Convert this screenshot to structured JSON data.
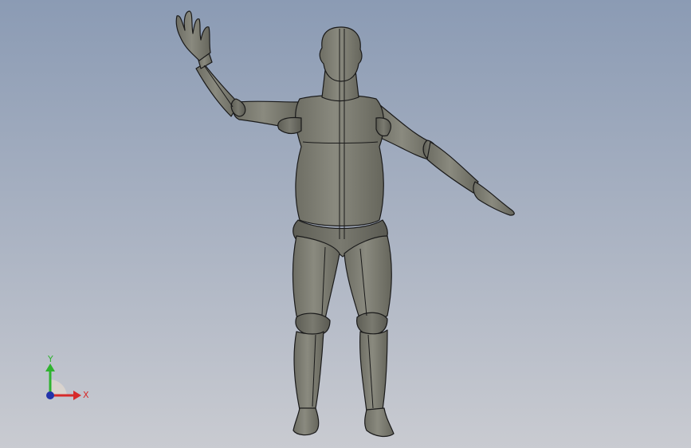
{
  "viewport": {
    "background_top": "#8b9bb4",
    "background_bottom": "#c9cbd1",
    "model": {
      "icon": "humanoid-mannequin-3d-model",
      "shade_color": "#7d7d72",
      "edge_color": "#1a1a1a"
    },
    "triad": {
      "icon": "reference-triad-icon",
      "y_label": "Y",
      "x_label": "X",
      "y_color": "#2fb32f",
      "x_color": "#d62a2a",
      "z_color": "#2233aa"
    }
  }
}
